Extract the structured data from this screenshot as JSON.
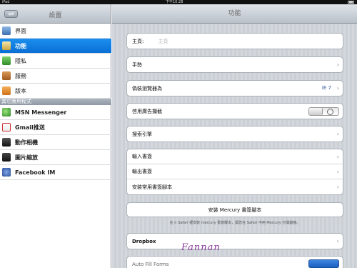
{
  "statusbar": {
    "carrier": "iPad",
    "time": "下午10:28"
  },
  "sidebar": {
    "title": "設置",
    "edit_label": "編輯",
    "items": [
      {
        "label": "界面",
        "icon": "interface-icon",
        "selected": false
      },
      {
        "label": "功能",
        "icon": "wand-icon",
        "selected": true
      },
      {
        "label": "隱私",
        "icon": "privacy-icon",
        "selected": false
      },
      {
        "label": "服務",
        "icon": "services-icon",
        "selected": false
      },
      {
        "label": "版本",
        "icon": "version-icon",
        "selected": false
      }
    ],
    "section_label": "其它應用程式",
    "apps": [
      {
        "label": "MSN Messenger",
        "icon": "msn-icon"
      },
      {
        "label": "Gmail推送",
        "icon": "gmail-icon"
      },
      {
        "label": "動作相機",
        "icon": "camera-icon"
      },
      {
        "label": "圖片縮放",
        "icon": "photo-icon"
      },
      {
        "label": "Facebook IM",
        "icon": "facebook-icon"
      }
    ]
  },
  "main": {
    "title": "功能",
    "homepage": {
      "label": "主頁:",
      "placeholder": "主頁"
    },
    "gesture": {
      "label": "手勢"
    },
    "user_agent": {
      "label": "偽裝瀏覽器為",
      "value": "IE 7"
    },
    "popup_block": {
      "label": "啓用廣告攔截"
    },
    "search_engine": {
      "label": "搜索引擎"
    },
    "bookmarks": [
      {
        "label": "輸入書簽"
      },
      {
        "label": "輸出書簽"
      },
      {
        "label": "安裝常用書簽腳本"
      }
    ],
    "mercury_button": "安裝 Mercury 書簽腳本",
    "mercury_hint": "在 n Safari 裡安裝 mercury 書簽腳本，讓您在 Safari 中用 Mercury 打開鏈接。",
    "dropbox": {
      "label": "Dropbox"
    },
    "autofill": {
      "label": "Auto Fill Forms"
    }
  },
  "signature_text": "Fannan"
}
